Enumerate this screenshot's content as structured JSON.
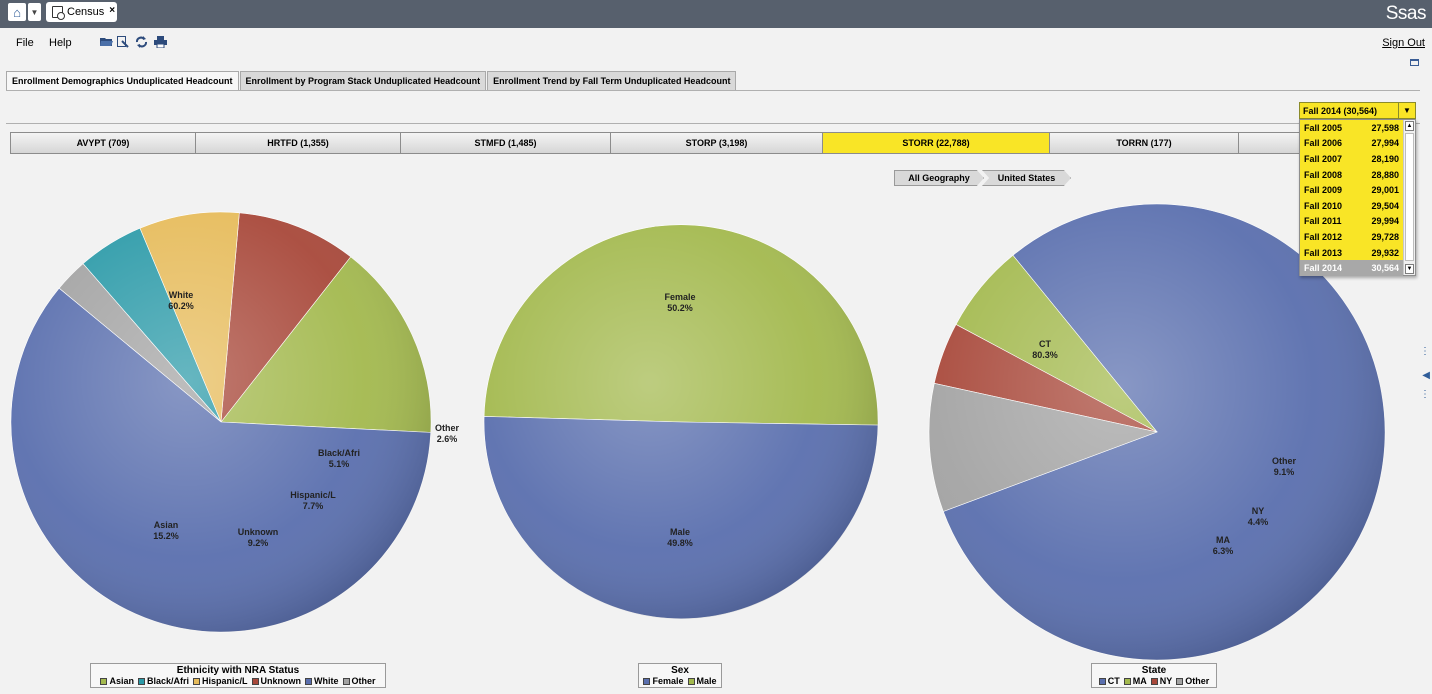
{
  "app": {
    "tab_title": "Census",
    "tab_close": "×",
    "brand": "Ssas"
  },
  "menu": {
    "file": "File",
    "help": "Help",
    "sign_out": "Sign Out"
  },
  "section_tabs": [
    "Enrollment Demographics Unduplicated Headcount",
    "Enrollment by Program Stack Unduplicated Headcount",
    "Enrollment Trend by Fall Term Unduplicated Headcount"
  ],
  "term_selector": {
    "selected": "Fall 2014 (30,564)",
    "options": [
      {
        "term": "Fall 2005",
        "count": "27,598"
      },
      {
        "term": "Fall 2006",
        "count": "27,994"
      },
      {
        "term": "Fall 2007",
        "count": "28,190"
      },
      {
        "term": "Fall 2008",
        "count": "28,880"
      },
      {
        "term": "Fall 2009",
        "count": "29,001"
      },
      {
        "term": "Fall 2010",
        "count": "29,504"
      },
      {
        "term": "Fall 2011",
        "count": "29,994"
      },
      {
        "term": "Fall 2012",
        "count": "29,728"
      },
      {
        "term": "Fall 2013",
        "count": "29,932"
      },
      {
        "term": "Fall 2014",
        "count": "30,564"
      }
    ]
  },
  "campuses": [
    "AVYPT (709)",
    "HRTFD (1,355)",
    "STMFD (1,485)",
    "STORP (3,198)",
    "STORR (22,788)",
    "TORRN (177)",
    ""
  ],
  "geography": {
    "all": "All Geography",
    "current": "United States"
  },
  "colors": {
    "blue": "#5a6fae",
    "green": "#a3b94e",
    "red": "#a8483a",
    "yellow": "#e6bb5a",
    "teal": "#2b9aa8",
    "gray": "#a3a3a3",
    "selected_campus": "#f9e526"
  },
  "chart_data": [
    {
      "type": "pie",
      "title": "Ethnicity with NRA Status",
      "categories": [
        "Asian",
        "Black/Afri",
        "Hispanic/L",
        "Unknown",
        "White",
        "Other"
      ],
      "values": [
        15.2,
        5.1,
        7.7,
        9.2,
        60.2,
        2.6
      ],
      "labels": [
        {
          "name": "White",
          "value": "60.2%"
        },
        {
          "name": "Asian",
          "value": "15.2%"
        },
        {
          "name": "Unknown",
          "value": "9.2%"
        },
        {
          "name": "Hispanic/L",
          "value": "7.7%"
        },
        {
          "name": "Black/Afri",
          "value": "5.1%"
        },
        {
          "name": "Other",
          "value": "2.6%"
        }
      ],
      "legend": [
        "Asian",
        "Black/Afri",
        "Hispanic/L",
        "Unknown",
        "White",
        "Other"
      ]
    },
    {
      "type": "pie",
      "title": "Sex",
      "categories": [
        "Female",
        "Male"
      ],
      "values": [
        50.2,
        49.8
      ],
      "labels": [
        {
          "name": "Female",
          "value": "50.2%"
        },
        {
          "name": "Male",
          "value": "49.8%"
        }
      ],
      "legend": [
        "Female",
        "Male"
      ]
    },
    {
      "type": "pie",
      "title": "State",
      "categories": [
        "CT",
        "MA",
        "NY",
        "Other"
      ],
      "values": [
        80.3,
        6.3,
        4.4,
        9.1
      ],
      "labels": [
        {
          "name": "CT",
          "value": "80.3%"
        },
        {
          "name": "MA",
          "value": "6.3%"
        },
        {
          "name": "NY",
          "value": "4.4%"
        },
        {
          "name": "Other",
          "value": "9.1%"
        }
      ],
      "legend": [
        "CT",
        "MA",
        "NY",
        "Other"
      ]
    }
  ]
}
